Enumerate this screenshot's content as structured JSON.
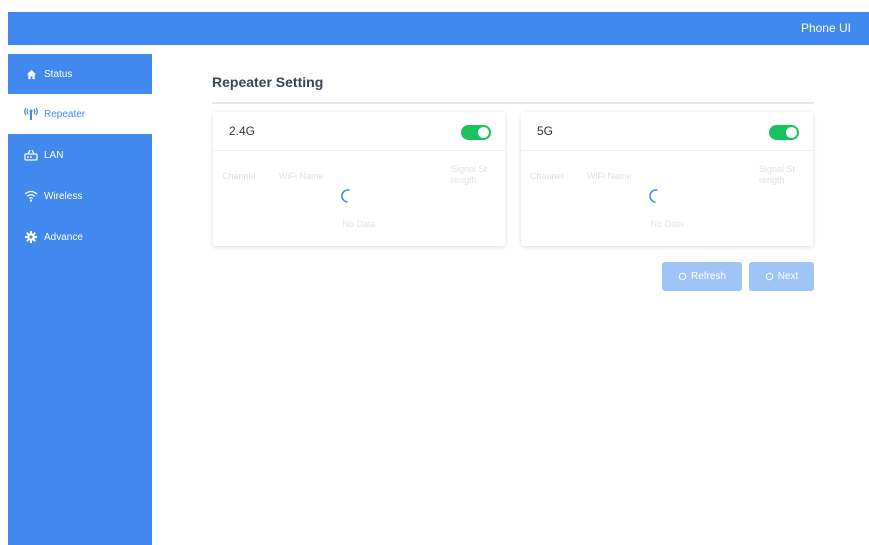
{
  "header": {
    "app_label": "Phone UI"
  },
  "sidebar": {
    "items": [
      {
        "label": "Status",
        "icon": "home-icon"
      },
      {
        "label": "Repeater",
        "icon": "repeater-antenna-icon"
      },
      {
        "label": "LAN",
        "icon": "router-icon"
      },
      {
        "label": "Wireless",
        "icon": "wifi-icon"
      },
      {
        "label": "Advance",
        "icon": "gear-icon"
      }
    ],
    "active_index": 1
  },
  "main": {
    "title": "Repeater Setting",
    "bands": [
      {
        "name": "2.4G",
        "enabled": true,
        "columns": [
          "Channel",
          "WiFi Name",
          "Signal St rength"
        ],
        "empty_text": "No Data"
      },
      {
        "name": "5G",
        "enabled": true,
        "columns": [
          "Channel",
          "WiFi Name",
          "Signal St rength"
        ],
        "empty_text": "No Data"
      }
    ],
    "buttons": {
      "refresh_label": "Refresh",
      "next_label": "Next"
    }
  },
  "colors": {
    "primary": "#4289ef",
    "button_disabled": "#9fc5f8",
    "toggle_on": "#17c25f"
  }
}
